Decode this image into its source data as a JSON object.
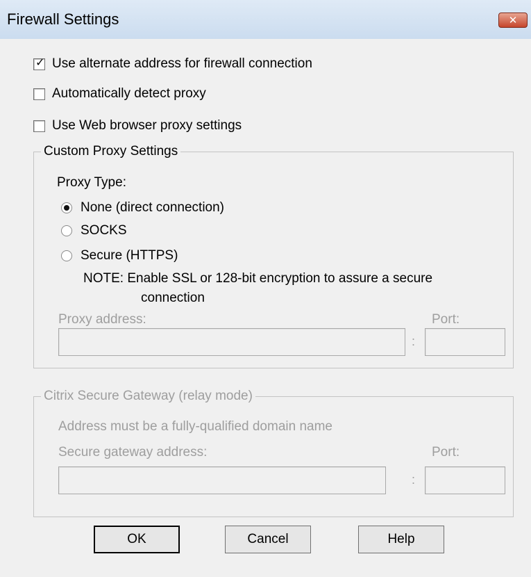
{
  "window": {
    "title": "Firewall Settings",
    "close_label": "✕"
  },
  "options": {
    "alt_address": {
      "label": "Use alternate address for firewall connection",
      "checked": true
    },
    "auto_detect": {
      "label": "Automatically detect proxy",
      "checked": false
    },
    "browser_proxy": {
      "label": "Use Web browser proxy settings",
      "checked": false
    }
  },
  "custom_proxy": {
    "legend": "Custom Proxy Settings",
    "proxy_type_label": "Proxy Type:",
    "radios": [
      {
        "label": "None (direct connection)",
        "selected": true
      },
      {
        "label": "SOCKS",
        "selected": false
      },
      {
        "label": "Secure (HTTPS)",
        "selected": false
      }
    ],
    "note_line1": "NOTE: Enable SSL or 128-bit encryption to assure a secure",
    "note_line2": "connection",
    "address_label": "Proxy address:",
    "address_value": "",
    "port_label": "Port:",
    "port_value": "",
    "separator": ":"
  },
  "gateway": {
    "legend": "Citrix Secure Gateway (relay mode)",
    "hint": "Address must be a fully-qualified domain name",
    "address_label": "Secure gateway address:",
    "address_value": "",
    "port_label": "Port:",
    "port_value": "",
    "separator": ":"
  },
  "buttons": {
    "ok": "OK",
    "cancel": "Cancel",
    "help": "Help"
  },
  "colors": {
    "titlebar": "#cbdcef",
    "client": "#f0f0f0",
    "disabled_text": "#9e9e9e",
    "close": "#c5462c"
  }
}
